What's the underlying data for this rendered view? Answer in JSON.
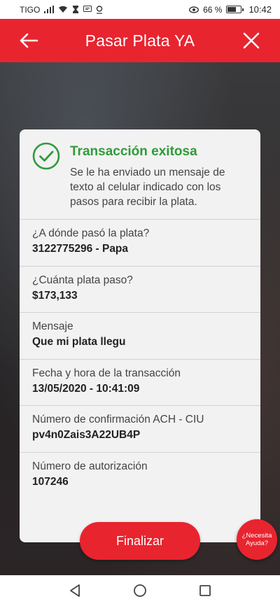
{
  "status_bar": {
    "carrier": "TIGO",
    "battery_percent": "66 %",
    "battery_level": 0.66,
    "time": "10:42"
  },
  "header": {
    "title": "Pasar Plata YA",
    "back_icon": "arrow-left-icon",
    "close_icon": "close-icon"
  },
  "success": {
    "icon": "check-circle-icon",
    "title": "Transacción exitosa",
    "message": "Se le ha enviado un mensaje de texto al celular indicado con los pasos para recibir la plata."
  },
  "fields": [
    {
      "label": "¿A dónde pasó la plata?",
      "value": "3122775296 - Papa"
    },
    {
      "label": "¿Cuánta plata paso?",
      "value": "$173,133"
    },
    {
      "label": "Mensaje",
      "value": "Que mi plata llegu"
    },
    {
      "label": "Fecha y hora de la transacción",
      "value": "13/05/2020 - 10:41:09"
    },
    {
      "label": "Número de confirmación ACH - CIU",
      "value": "pv4n0Zais3A22UB4P"
    },
    {
      "label": "Número de autorización",
      "value": "107246"
    }
  ],
  "actions": {
    "finalize_label": "Finalizar",
    "help_line1": "¿Necesita",
    "help_line2": "Ayuda?"
  },
  "colors": {
    "brand_red": "#e8242f",
    "success_green": "#2f9b3a"
  }
}
